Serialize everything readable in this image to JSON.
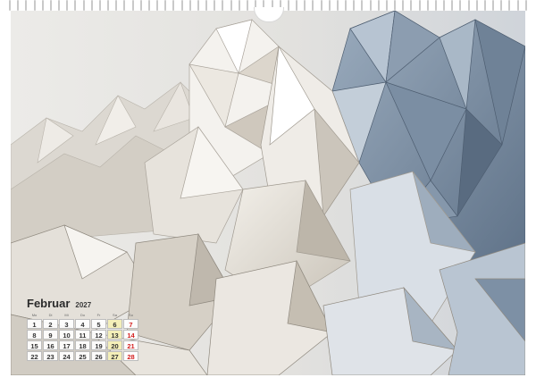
{
  "calendar": {
    "month": "Februar",
    "year": "2027",
    "weekdays": [
      "Mo",
      "Di",
      "Mi",
      "Do",
      "Fr",
      "Sa",
      "So"
    ],
    "weeks": [
      [
        "1",
        "2",
        "3",
        "4",
        "5",
        "6",
        "7"
      ],
      [
        "8",
        "9",
        "10",
        "11",
        "12",
        "13",
        "14"
      ],
      [
        "15",
        "16",
        "17",
        "18",
        "19",
        "20",
        "21"
      ],
      [
        "22",
        "23",
        "24",
        "25",
        "26",
        "27",
        "28"
      ]
    ]
  },
  "colors": {
    "sunday": "#d42020",
    "photo_light": "#e8e6e2",
    "photo_blue": "#7f93a8"
  },
  "icons": [
    "wire-binding",
    "hanger-notch"
  ]
}
